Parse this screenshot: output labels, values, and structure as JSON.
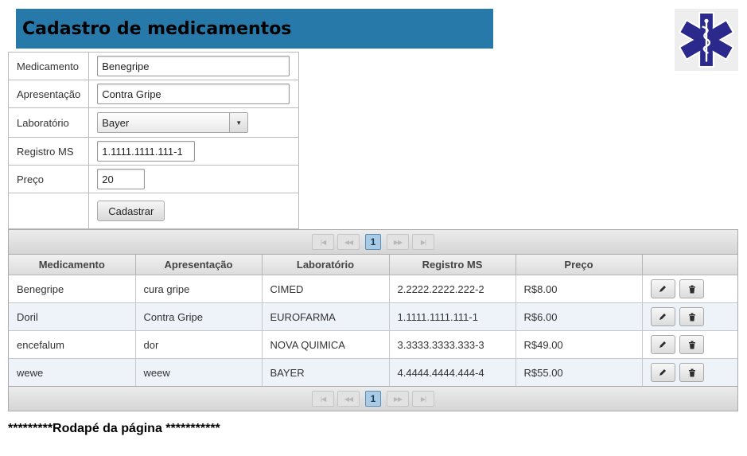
{
  "header": {
    "title": "Cadastro de medicamentos",
    "background_color": "#2779aa",
    "logo_icon": "star-of-life-icon",
    "logo_color": "#2b2a8c"
  },
  "form": {
    "fields": {
      "medicamento": {
        "label": "Medicamento",
        "value": "Benegripe"
      },
      "apresentacao": {
        "label": "Apresentação",
        "value": "Contra Gripe"
      },
      "laboratorio": {
        "label": "Laboratório",
        "value": "Bayer"
      },
      "registro": {
        "label": "Registro MS",
        "value": "1.1111.1111.111-1"
      },
      "preco": {
        "label": "Preço",
        "value": "20"
      }
    },
    "submit_label": "Cadastrar"
  },
  "grid": {
    "columns": [
      "Medicamento",
      "Apresentação",
      "Laboratório",
      "Registro MS",
      "Preço",
      ""
    ],
    "rows": [
      {
        "medicamento": "Benegripe",
        "apresentacao": "cura gripe",
        "laboratorio": "CIMED",
        "registro": "2.2222.2222.222-2",
        "preco": "R$8.00"
      },
      {
        "medicamento": "Doril",
        "apresentacao": "Contra Gripe",
        "laboratorio": "EUROFARMA",
        "registro": "1.1111.1111.111-1",
        "preco": "R$6.00"
      },
      {
        "medicamento": "encefalum",
        "apresentacao": "dor",
        "laboratorio": "NOVA QUIMICA",
        "registro": "3.3333.3333.333-3",
        "preco": "R$49.00"
      },
      {
        "medicamento": "wewe",
        "apresentacao": "weew",
        "laboratorio": "BAYER",
        "registro": "4.4444.4444.444-4",
        "preco": "R$55.00"
      }
    ],
    "paginator": {
      "current_page": "1",
      "buttons": [
        "first-page-icon",
        "prev-page-icon",
        "next-page-icon",
        "last-page-icon"
      ]
    },
    "row_actions": [
      "pencil-icon",
      "trash-icon"
    ]
  },
  "footer": {
    "text": "*********Rodapé da página ***********"
  }
}
